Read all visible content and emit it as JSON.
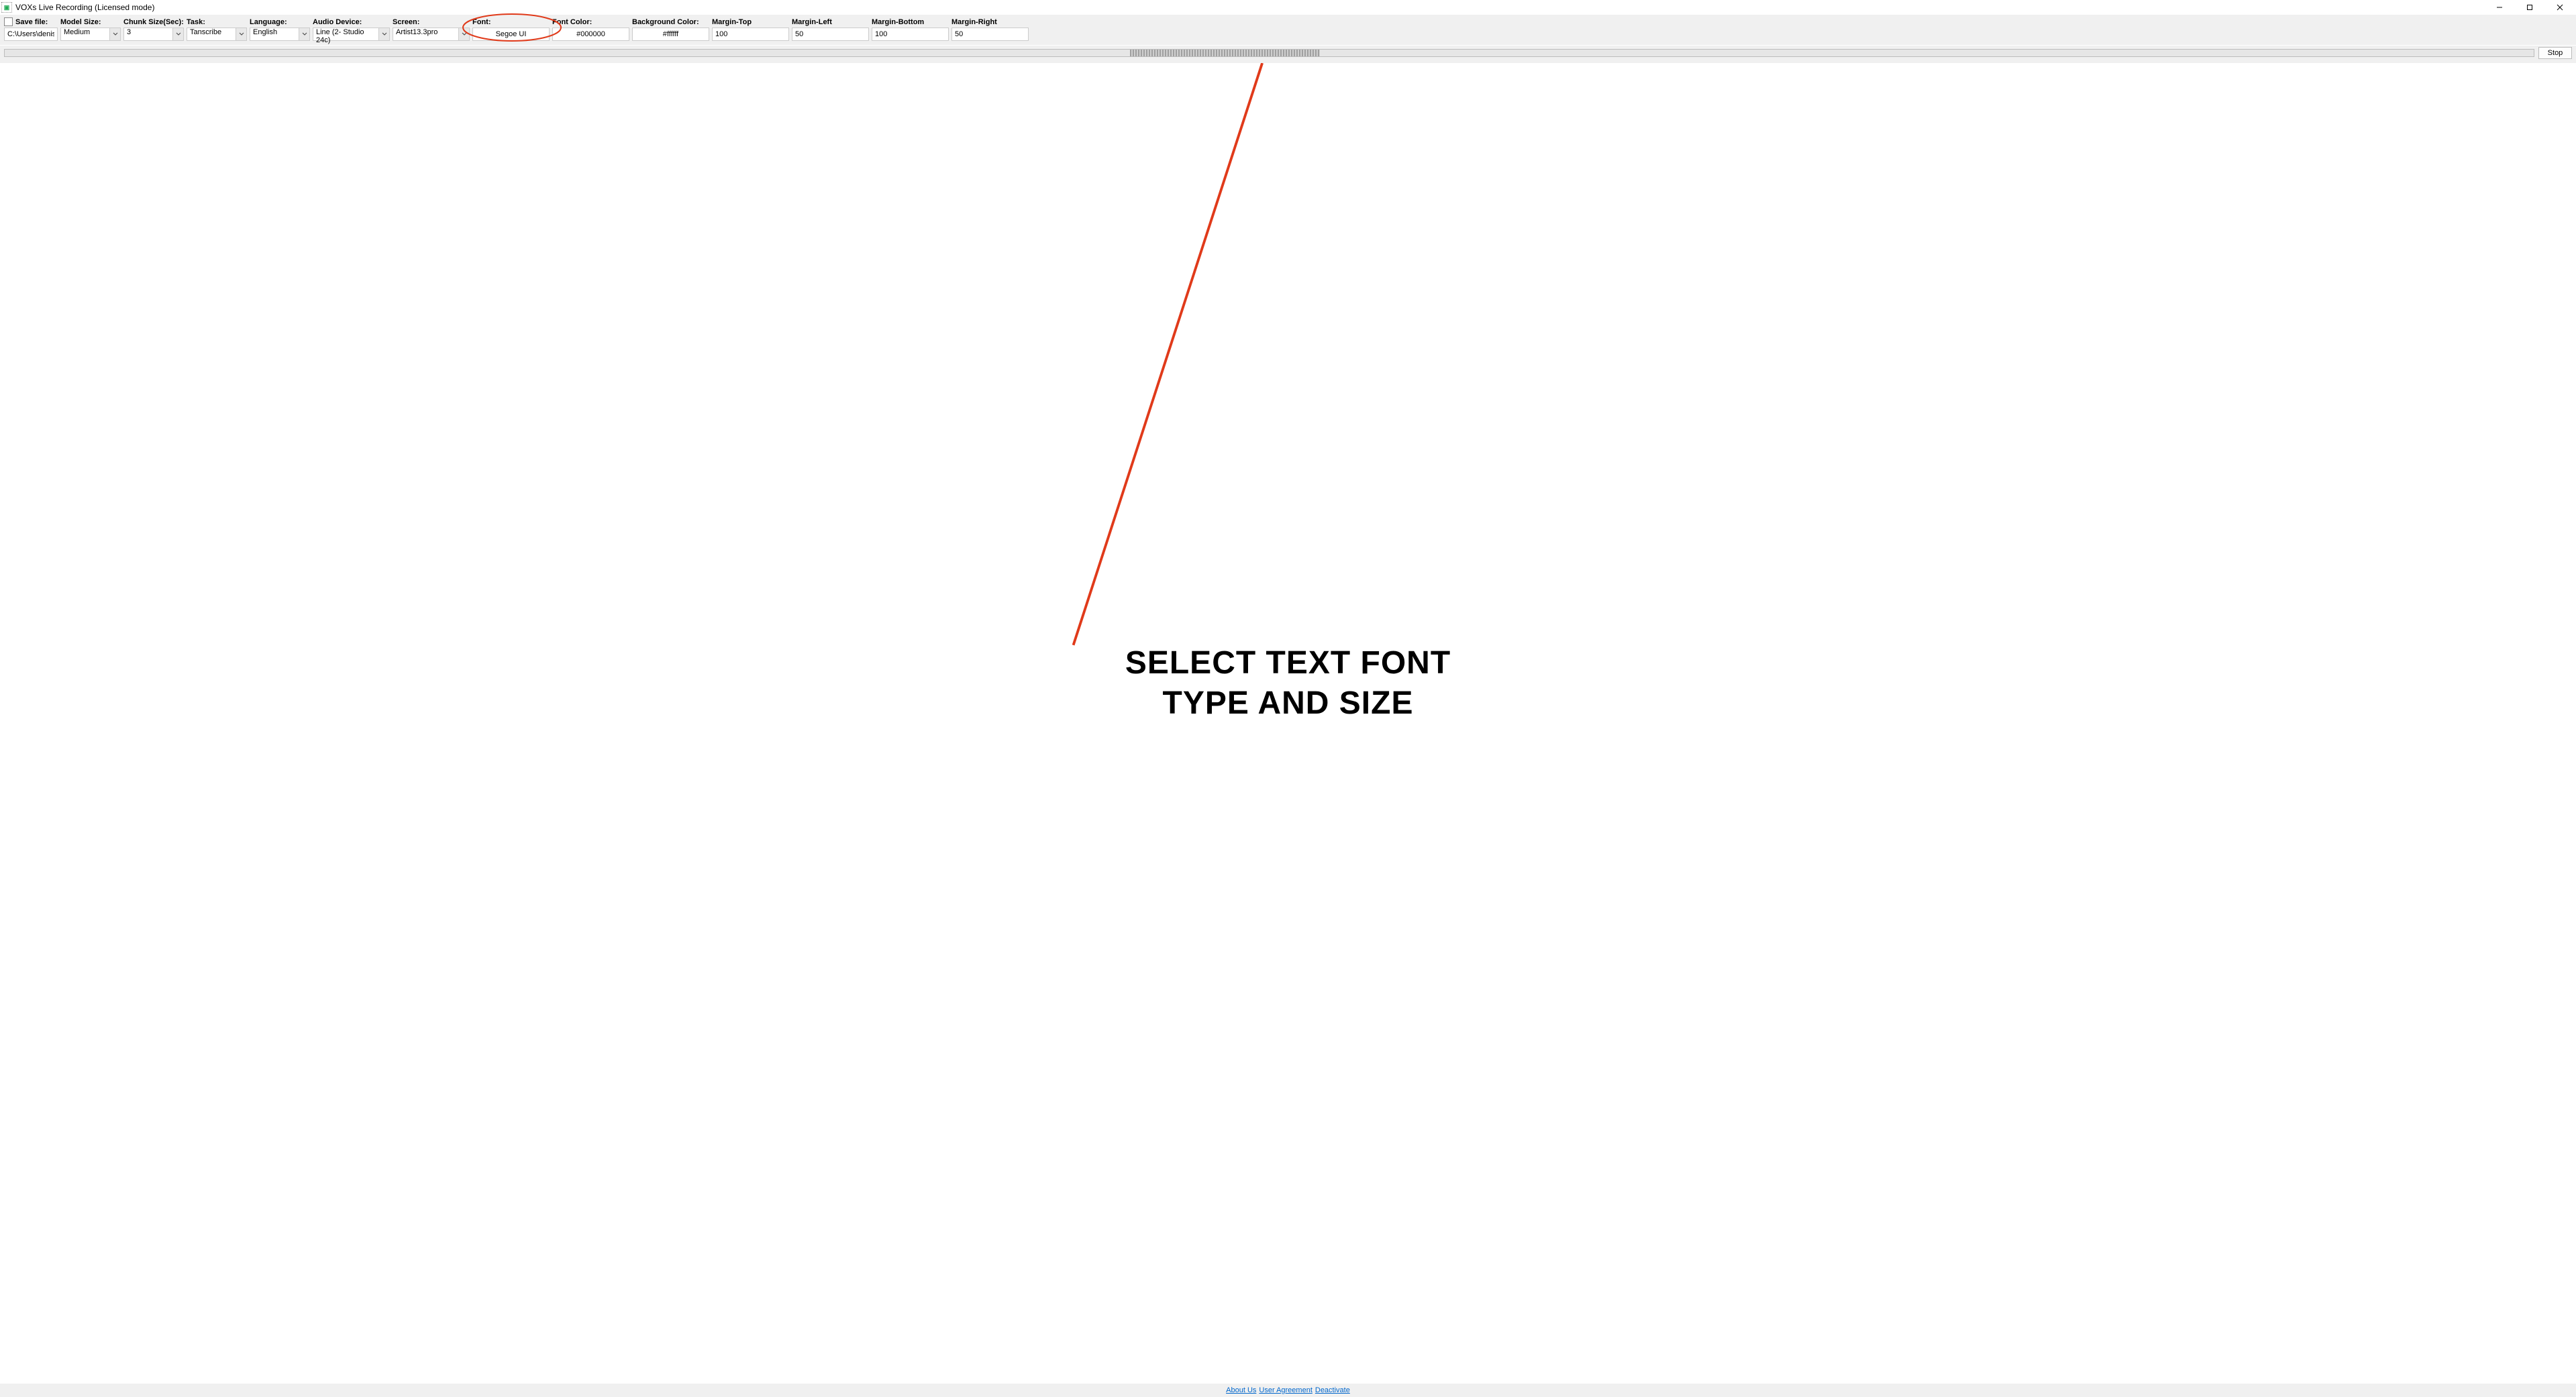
{
  "window": {
    "title": "VOXs Live Recording (Licensed mode)"
  },
  "toolbar": {
    "save_file": {
      "label": "Save file:",
      "value": "C:\\Users\\denis\\Desktop"
    },
    "model_size": {
      "label": "Model Size:",
      "value": "Medium"
    },
    "chunk_size": {
      "label": "Chunk Size(Sec):",
      "value": "3"
    },
    "task": {
      "label": "Task:",
      "value": "Tanscribe"
    },
    "language": {
      "label": "Language:",
      "value": "English"
    },
    "audio_device": {
      "label": "Audio Device:",
      "value": "Line (2- Studio 24c)"
    },
    "screen": {
      "label": "Screen:",
      "value": "Artist13.3pro"
    },
    "font": {
      "label": "Font:",
      "value": "Segoe UI"
    },
    "font_color": {
      "label": "Font Color:",
      "value": "#000000"
    },
    "bg_color": {
      "label": "Background Color:",
      "value": "#ffffff"
    },
    "margin_top": {
      "label": "Margin-Top",
      "value": "100"
    },
    "margin_left": {
      "label": "Margin-Left",
      "value": "50"
    },
    "margin_bottom": {
      "label": "Margin-Bottom",
      "value": "100"
    },
    "margin_right": {
      "label": "Margin-Right",
      "value": "50"
    }
  },
  "runbar": {
    "stop_label": "Stop"
  },
  "annotation": {
    "text_line1": "SELECT TEXT FONT",
    "text_line2": "TYPE AND SIZE"
  },
  "footer": {
    "about": "About Us",
    "agreement": "User Agreement",
    "deactivate": "Deactivate"
  }
}
